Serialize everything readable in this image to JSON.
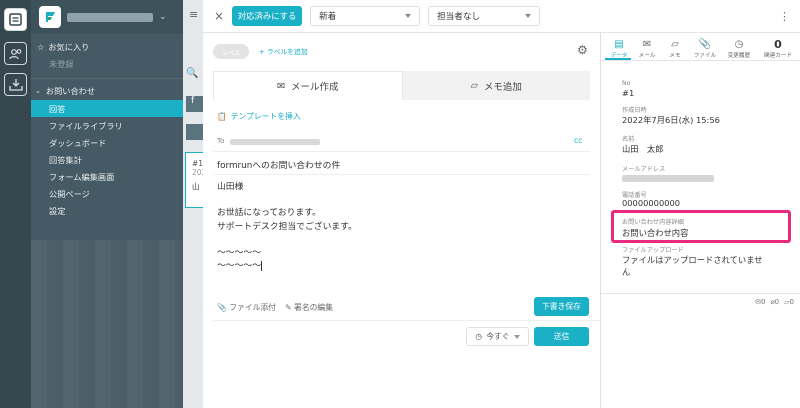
{
  "topbar": {
    "close_symbol": "×",
    "mark_handled": "対応済みにする",
    "status_value": "新着",
    "assignee_value": "担当者なし",
    "more_symbol": "⋮"
  },
  "sidebar": {
    "favorites": "お気に入り",
    "unregistered": "未登録",
    "section": "お問い合わせ",
    "items": [
      "回答",
      "ファイルライブラリ",
      "ダッシュボード",
      "回答集計",
      "フォーム編集画面",
      "公開ページ",
      "設定"
    ],
    "active_index": 0
  },
  "list_pane": {
    "f": "f",
    "count_prefix": "#1",
    "year_prefix": "202",
    "name_prefix": "山"
  },
  "compose": {
    "label_chip": "ラベル",
    "add_label": "+ ラベルを追加",
    "tab_mail": "メール作成",
    "tab_memo": "メモ追加",
    "insert_template": "テンプレートを挿入",
    "to_label": "To",
    "cc_label": "cc",
    "subject": "formrunへのお問い合わせの件",
    "body_lines": [
      "山田様",
      "",
      "お世話になっております。",
      "サポートデスク担当でございます。",
      "",
      "〜〜〜〜〜",
      "〜〜〜〜〜"
    ],
    "attach": "ファイル添付",
    "signature": "署名の編集",
    "save_draft": "下書き保存",
    "send_time": "今すぐ",
    "send": "送信"
  },
  "details": {
    "tabs": [
      {
        "icon": "data-icon",
        "label": "データ"
      },
      {
        "icon": "mail-icon",
        "label": "メール"
      },
      {
        "icon": "memo-icon",
        "label": "メモ"
      },
      {
        "icon": "file-icon",
        "label": "ファイル"
      },
      {
        "icon": "history-icon",
        "label": "変更履歴"
      },
      {
        "icon": "card-count",
        "label": "関連カード",
        "value": "0"
      }
    ],
    "fields": [
      {
        "label": "No",
        "value": "#1"
      },
      {
        "label": "作成日時",
        "value": "2022年7月6日(水) 15:56"
      },
      {
        "label": "名前",
        "value": "山田　太郎"
      },
      {
        "label": "メールアドレス",
        "value": ""
      },
      {
        "label": "電話番号",
        "value": "00000000000"
      },
      {
        "label": "お問い合わせ内容詳細",
        "value": "お問い合わせ内容"
      },
      {
        "label": "ファイルアップロード",
        "value": "ファイルはアップロードされていませ",
        "value2": "ん"
      }
    ],
    "footer_counts": {
      "mail": "0",
      "file": "0",
      "memo": "0"
    }
  },
  "colors": {
    "accent": "#1ab0c6",
    "sidebar": "#455a64",
    "highlight": "#ea2a7c"
  }
}
